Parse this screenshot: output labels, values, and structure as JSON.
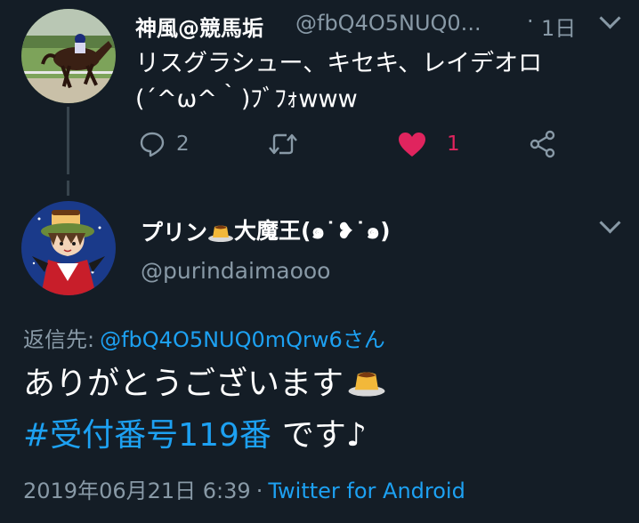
{
  "colors": {
    "background": "#141d26",
    "primary_text": "#ffffff",
    "secondary_text": "#8899a6",
    "accent": "#1da1f2",
    "like": "#e0245e"
  },
  "tweet1": {
    "display_name": "神風@競馬垢",
    "handle": "@fbQ4O5NUQ0...",
    "separator": "·",
    "time": "1日",
    "text_line1": "リスグラシュー、キセキ、レイデオロ",
    "text_line2": "(´^ω^｀)ﾌﾞﾌｫwww",
    "actions": {
      "reply_count": "2",
      "retweet_count": "",
      "like_count": "1",
      "liked": true
    },
    "icons": [
      "reply-icon",
      "retweet-icon",
      "heart-icon",
      "share-icon",
      "chevron-down-icon"
    ]
  },
  "tweet2": {
    "display_name": "プリン",
    "display_name_suffix": "大魔王(๑˙❥˙๑)",
    "handle": "@purindaimaooo",
    "reply_to_label": "返信先:",
    "reply_to_mention": "@fbQ4O5NUQ0mQrw6さん",
    "text_line1": "ありがとうございます",
    "hashtag": "#受付番号119番",
    "text_line2_rest": "です♪",
    "date": "2019年06月21日 6:39",
    "separator": "·",
    "client": "Twitter for Android"
  }
}
